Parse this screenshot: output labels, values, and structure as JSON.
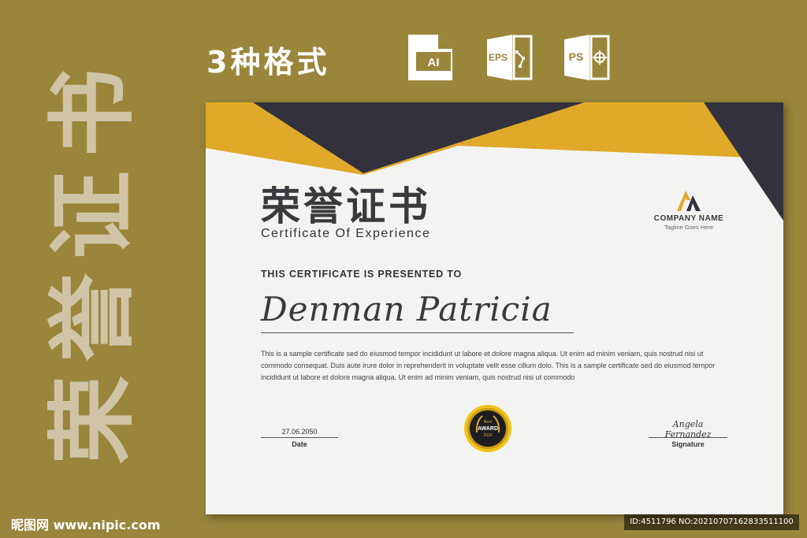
{
  "side_title": [
    "荣",
    "誉",
    "证",
    "书"
  ],
  "formats_label": "3种格式",
  "file_formats": [
    {
      "label": "AI",
      "icon": "ai-file-icon"
    },
    {
      "label": "EPS",
      "icon": "eps-file-icon"
    },
    {
      "label": "PS",
      "icon": "ps-file-icon"
    }
  ],
  "certificate": {
    "title": "荣誉证书",
    "subtitle": "Certificate Of Experience",
    "company_name": "COMPANY NAME",
    "company_tagline": "Tagline Goes Here",
    "presented_to": "THIS CERTIFICATE IS PRESENTED TO",
    "recipient": "Denman Patricia",
    "body": "This is a sample certificate sed do eiusmod tempor incididunt ut labore et dolore magna aliqua. Ut enim ad minim veniam, quis nostrud nisi ut commodo consequat. Duis aute irure dolor in reprehenderit in voluptate velit esse cillum dolo. This is a sample certificate sed do eiusmod tempor incididunt ut labore et dolore magna aliqua. Ut enim ad minim veniam, quis nostrud nisi ut commodo",
    "date_value": "27.06.2050",
    "date_label": "Date",
    "badge": {
      "line1": "Best",
      "line2": "AWARD",
      "line3": "2020"
    },
    "signature_script": "Angela Fernandez",
    "signature_label": "Signature"
  },
  "watermark": "昵图网 www.nipic.com",
  "image_id": "ID:4511796 NO:20210707162833511100",
  "colors": {
    "background": "#9a853b",
    "gold": "#e0a92a",
    "dark": "#33323c",
    "paper": "#f3f3f1"
  }
}
